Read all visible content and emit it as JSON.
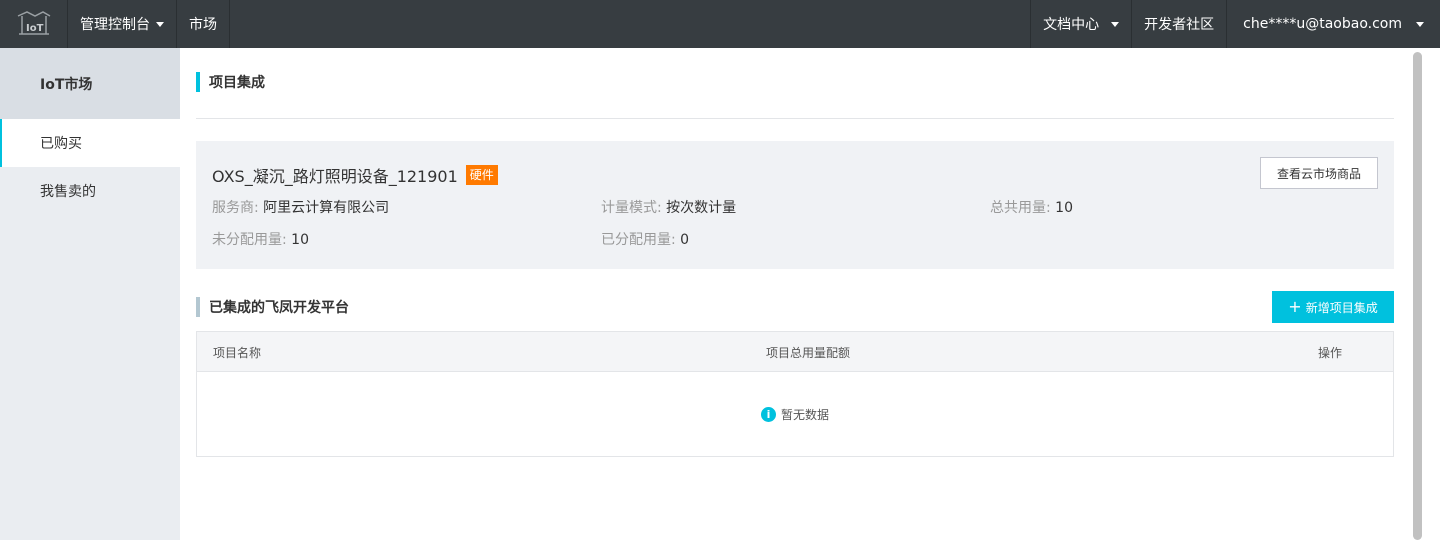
{
  "topbar": {
    "logo_icon": "iot-logo-icon",
    "console_label": "管理控制台",
    "market_label": "市场",
    "docs_label": "文档中心",
    "dev_community_label": "开发者社区",
    "user_email": "che****u@taobao.com"
  },
  "sidebar": {
    "header": "IoT市场",
    "items": [
      {
        "label": "已购买",
        "active": true
      },
      {
        "label": "我售卖的",
        "active": false
      }
    ]
  },
  "main": {
    "section1_title": "项目集成",
    "card": {
      "product_name": "OXS_凝沉_路灯照明设备_121901",
      "tag": "硬件",
      "view_button": "查看云市场商品",
      "provider_label": "服务商:",
      "provider_value": "阿里云计算有限公司",
      "billing_mode_label": "计量模式:",
      "billing_mode_value": "按次数计量",
      "total_usage_label": "总共用量:",
      "total_usage_value": "10",
      "unallocated_label": "未分配用量:",
      "unallocated_value": "10",
      "allocated_label": "已分配用量:",
      "allocated_value": "0"
    },
    "section2_title": "已集成的飞凤开发平台",
    "add_button": "新增项目集成",
    "table": {
      "columns": [
        "项目名称",
        "项目总用量配额",
        "操作"
      ],
      "rows": [],
      "empty_text": "暂无数据"
    }
  },
  "colors": {
    "topbar_bg": "#373d41",
    "accent": "#00c1de",
    "tag_orange": "#ff7a00",
    "sidebar_bg": "#eaedf1"
  }
}
